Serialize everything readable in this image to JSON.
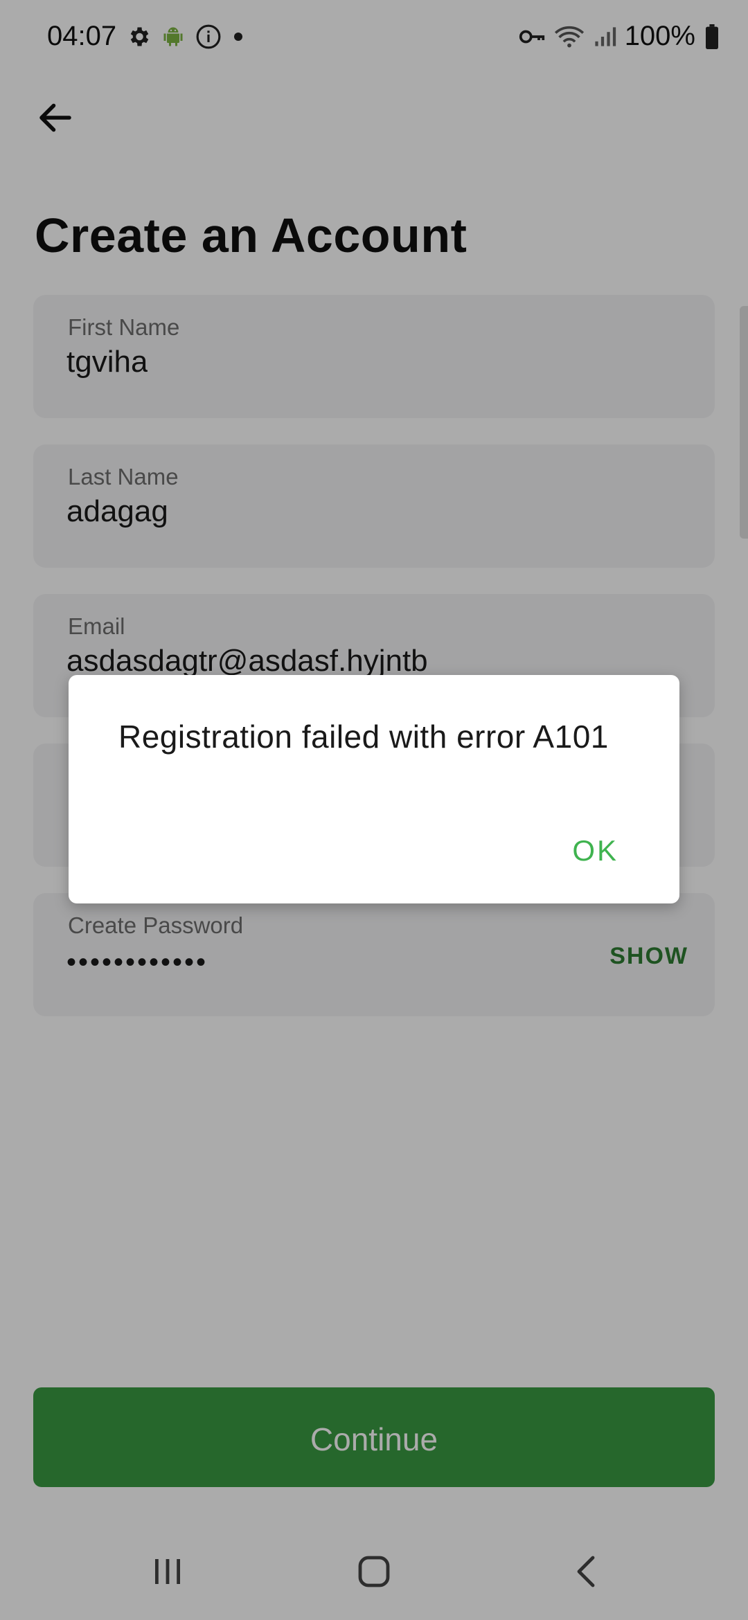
{
  "status_bar": {
    "time": "04:07",
    "battery_text": "100%",
    "icons": [
      "gear-icon",
      "android-icon",
      "info-icon",
      "dot-icon",
      "vpn-key-icon",
      "wifi-icon",
      "signal-icon",
      "battery-icon"
    ]
  },
  "header": {
    "back_icon": "arrow-left-icon",
    "title": "Create an Account"
  },
  "form": {
    "first_name": {
      "label": "First Name",
      "value": "tgviha"
    },
    "last_name": {
      "label": "Last Name",
      "value": "adagag"
    },
    "email": {
      "label": "Email",
      "value": "asdasdagtr@asdasf.hyjntb"
    },
    "password": {
      "label": "Create Password",
      "value": "••••••••••••",
      "show_label": "SHOW"
    }
  },
  "continue_button": {
    "label": "Continue",
    "color": "#3a9a42"
  },
  "dialog": {
    "message": "Registration failed with error A101",
    "ok_label": "OK",
    "ok_color": "#3fb34f"
  },
  "nav_bar": {
    "icons": [
      "recent-apps-icon",
      "home-icon",
      "back-nav-icon"
    ]
  }
}
